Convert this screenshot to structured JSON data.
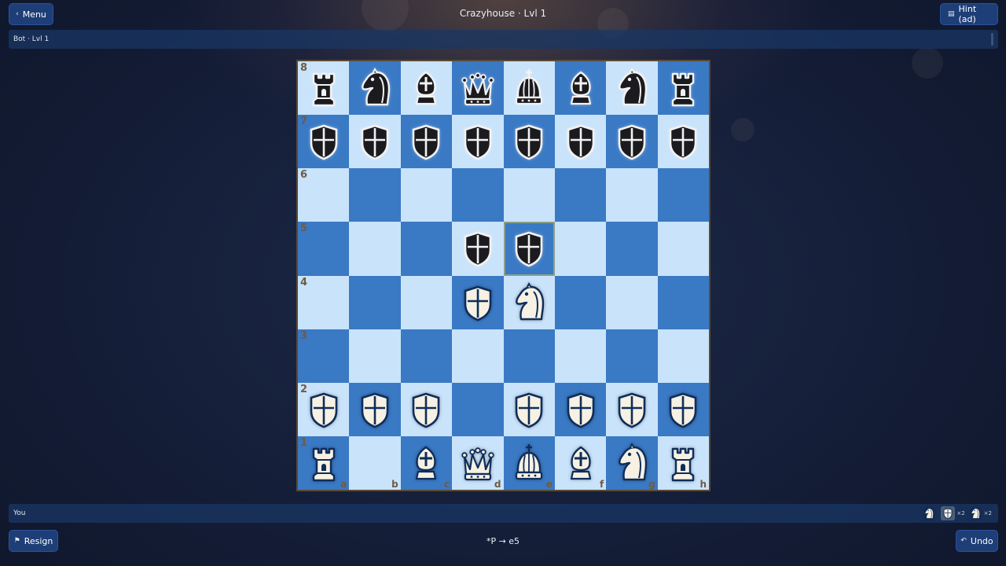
{
  "header": {
    "title": "Crazyhouse · Lvl 1",
    "menu_label": "Menu",
    "hint_label": "Hint (ad)"
  },
  "top_player": {
    "label": "Bot · Lvl 1"
  },
  "bottom_player": {
    "label": "You",
    "pocket": [
      {
        "piece": "knight",
        "color": "white",
        "count": ""
      },
      {
        "piece": "pawn",
        "color": "white",
        "count": "×2"
      },
      {
        "piece": "knight",
        "color": "white",
        "count": "×2"
      }
    ]
  },
  "footer": {
    "resign_label": "Resign",
    "undo_label": "Undo",
    "last_move": "*P → e5"
  },
  "board": {
    "ranks": [
      "8",
      "7",
      "6",
      "5",
      "4",
      "3",
      "2",
      "1"
    ],
    "files": [
      "a",
      "b",
      "c",
      "d",
      "e",
      "f",
      "g",
      "h"
    ],
    "rows": [
      [
        "bR",
        "bN",
        "bB",
        "bQ",
        "bK",
        "bB",
        "bN",
        "bR"
      ],
      [
        "bP",
        "bP",
        "bP",
        "bP",
        "bP",
        "bP",
        "bP",
        "bP"
      ],
      [
        "",
        "",
        "",
        "",
        "",
        "",
        "",
        ""
      ],
      [
        "",
        "",
        "",
        "bP",
        "bP",
        "",
        "",
        ""
      ],
      [
        "",
        "",
        "",
        "wP",
        "wN",
        "",
        "",
        ""
      ],
      [
        "",
        "",
        "",
        "",
        "",
        "",
        "",
        ""
      ],
      [
        "wP",
        "wP",
        "wP",
        "",
        "wP",
        "wP",
        "wP",
        "wP"
      ],
      [
        "wR",
        "",
        "wB",
        "wQ",
        "wK",
        "wB",
        "wN",
        "wR"
      ]
    ],
    "highlight_square": "e5",
    "colors": {
      "light": "#c9e3fb",
      "dark": "#3a79c4"
    }
  }
}
